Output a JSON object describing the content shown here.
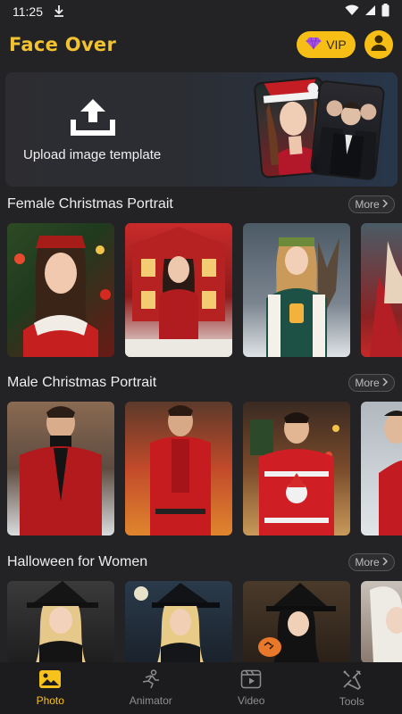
{
  "status_bar": {
    "time": "11:25"
  },
  "header": {
    "title": "Face Over",
    "vip_label": "VIP"
  },
  "upload": {
    "label": "Upload image template"
  },
  "sections": [
    {
      "title": "Female Christmas Portrait",
      "more_label": "More"
    },
    {
      "title": "Male Christmas Portrait",
      "more_label": "More"
    },
    {
      "title": "Halloween for Women",
      "more_label": "More"
    }
  ],
  "nav": {
    "items": [
      {
        "label": "Photo",
        "icon": "image-icon",
        "active": true
      },
      {
        "label": "Animator",
        "icon": "runner-icon",
        "active": false
      },
      {
        "label": "Video",
        "icon": "video-icon",
        "active": false
      },
      {
        "label": "Tools",
        "icon": "tools-icon",
        "active": false
      }
    ]
  },
  "colors": {
    "accent": "#f7be16",
    "title": "#f2c230",
    "background": "#232326"
  }
}
